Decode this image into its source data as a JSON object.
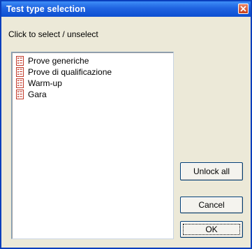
{
  "window": {
    "title": "Test type selection",
    "close_icon": "close-icon"
  },
  "instructions": "Click to select / unselect",
  "list": {
    "item_icon": "list-document-icon",
    "items": [
      {
        "label": "Prove generiche"
      },
      {
        "label": "Prove di qualificazione"
      },
      {
        "label": "Warm-up"
      },
      {
        "label": "Gara"
      }
    ]
  },
  "buttons": {
    "unlock_all": "Unlock all",
    "cancel": "Cancel",
    "ok": "OK"
  },
  "colors": {
    "title_bar": "#1f63e0",
    "dialog_background": "#ece9d8",
    "close_button": "#c9401c"
  }
}
